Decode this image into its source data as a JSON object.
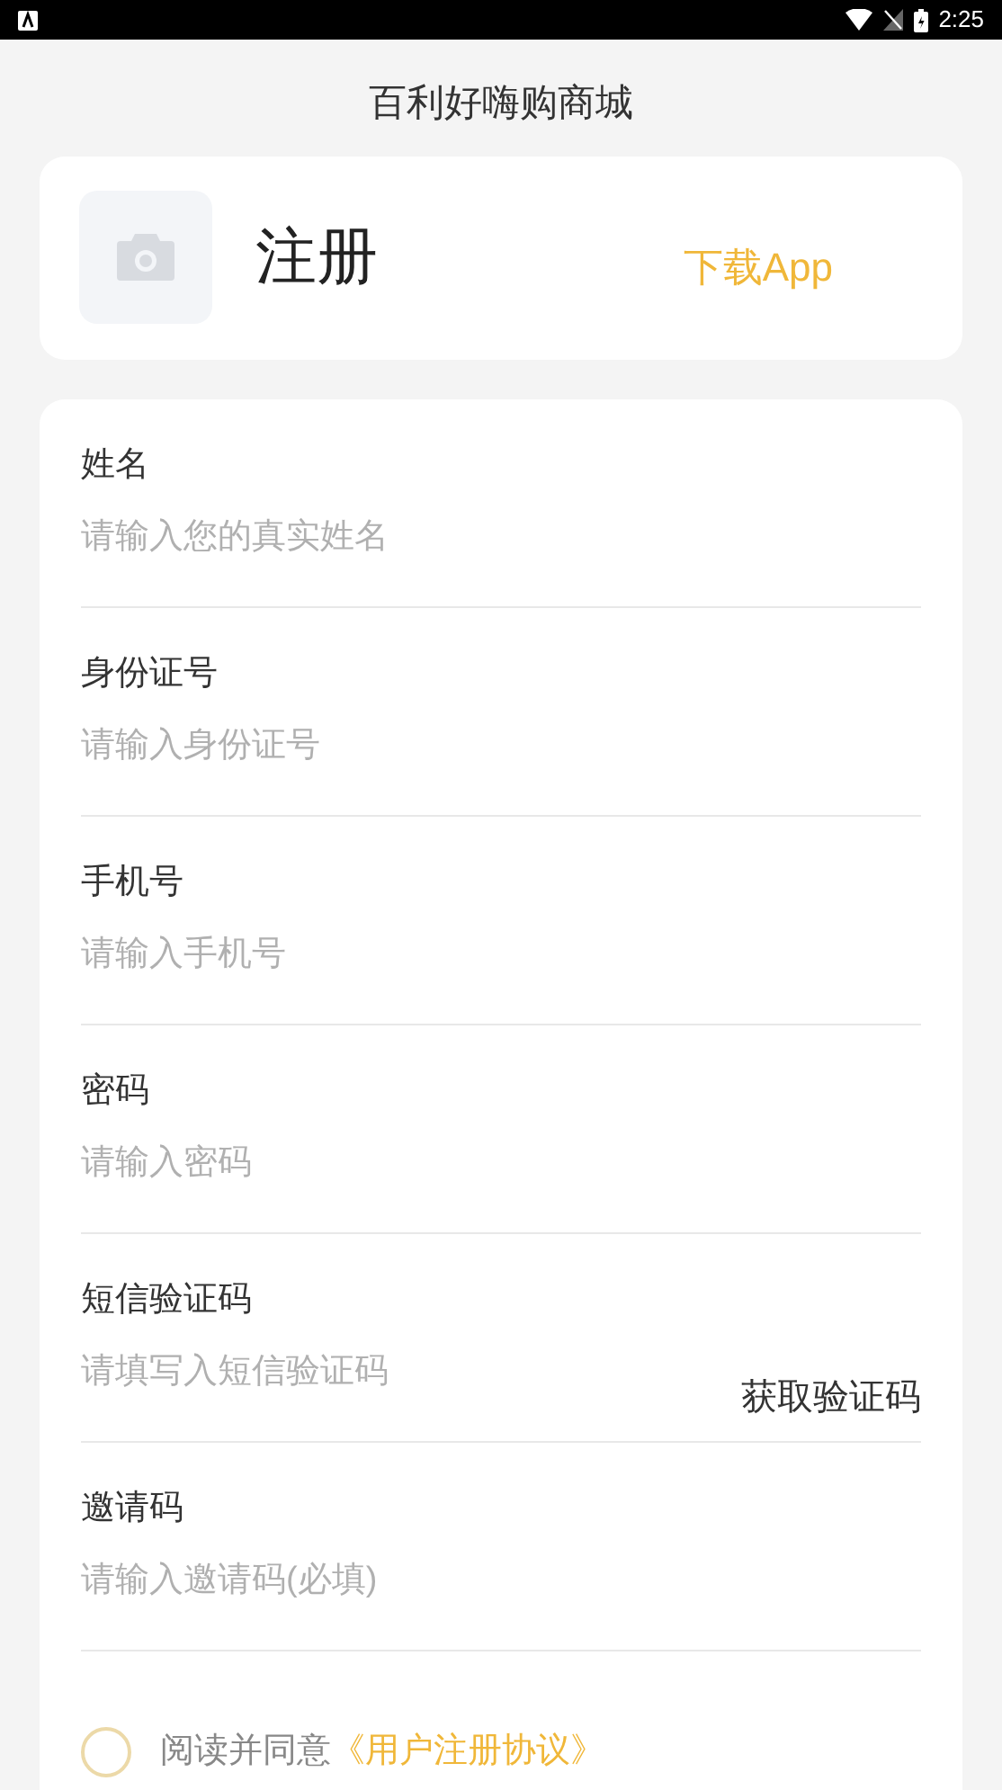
{
  "status_bar": {
    "time": "2:25"
  },
  "title": "百利好嗨购商城",
  "header": {
    "heading": "注册",
    "download_link": "下载App"
  },
  "fields": [
    {
      "label": "姓名",
      "placeholder": "请输入您的真实姓名"
    },
    {
      "label": "身份证号",
      "placeholder": "请输入身份证号"
    },
    {
      "label": "手机号",
      "placeholder": "请输入手机号"
    },
    {
      "label": "密码",
      "placeholder": "请输入密码"
    },
    {
      "label": "短信验证码",
      "placeholder": "请填写入短信验证码",
      "button": "获取验证码"
    },
    {
      "label": "邀请码",
      "placeholder": "请输入邀请码(必填)"
    }
  ],
  "agreement": {
    "checked": false,
    "text": "阅读并同意",
    "link": "《用户注册协议》"
  }
}
